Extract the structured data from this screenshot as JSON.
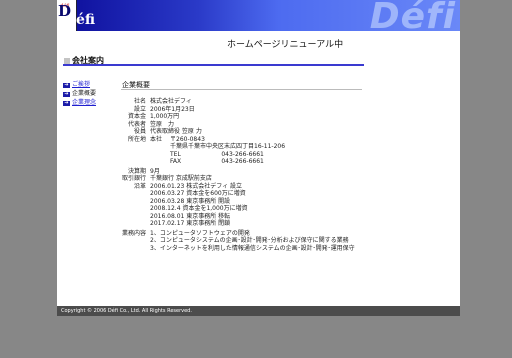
{
  "header": {
    "logo_small": "défi",
    "logo_d": "D",
    "logo_efi": "éfi",
    "watermark": "Défi"
  },
  "renewal_notice": "ホームページリニューアル中",
  "section_title": "会社案内",
  "nav": [
    {
      "label": "ご挨拶",
      "current": false
    },
    {
      "label": "企業概要",
      "current": true
    },
    {
      "label": "企業理念",
      "current": false
    }
  ],
  "content_heading": "企業概要",
  "company": {
    "name_label": "社名",
    "name": "株式会社デフィ",
    "est_label": "設立",
    "est": "2006年1月23日",
    "capital_label": "資本金",
    "capital": "1,000万円",
    "rep_label": "代表者",
    "rep": "笠原　力",
    "officer_label": "役員",
    "officer": "代表取締役 笠原 力",
    "address_label": "所在地",
    "address_branch": "本社",
    "postal": "〒260-0843",
    "address": "千葉県千葉市中央区末広四丁目16-11-206",
    "tel_label": "TEL",
    "tel": "043-266-6661",
    "fax_label": "FAX",
    "fax": "043-266-6661",
    "fiscal_label": "決算期",
    "fiscal": "9月",
    "bank_label": "取引銀行",
    "bank": "千葉銀行 京成駅前支店",
    "history_label": "沿革",
    "history": [
      "2006.01.23 株式会社デフィ 設立",
      "2006.03.27 資本金を600万に増資",
      "2006.03.28 東京事務所 開設",
      "2008.12.4 資本金を1,000万に増資",
      "2016.08.01 東京事務所 移転",
      "2017.02.17 東京事務所 閉鎖"
    ],
    "business_label": "業務内容",
    "business": [
      "1、コンピュータソフトウェアの開発",
      "2、コンピュータシステムの企画･設計･開発･分析および保守に関する業務",
      "3、インターネットを利用した情報通信システムの企画･設計･開発･運用保守"
    ]
  },
  "footer": "Copyright © 2006 Défi Co., Ltd. All Rights Reserved."
}
